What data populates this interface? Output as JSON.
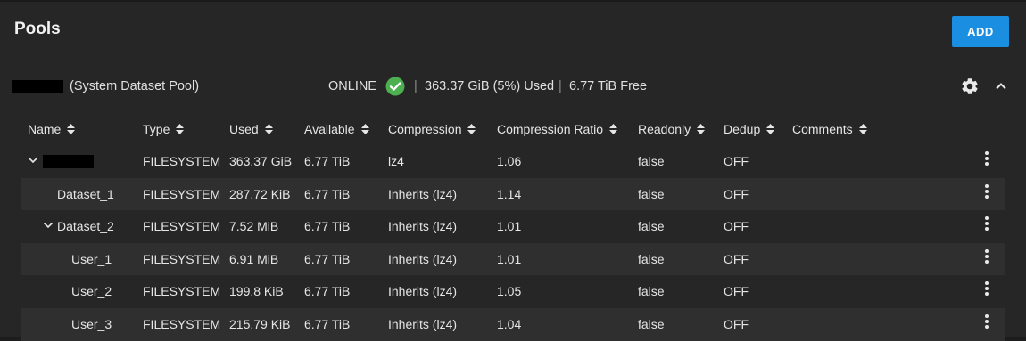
{
  "page": {
    "title": "Pools"
  },
  "actions": {
    "add_label": "ADD"
  },
  "pool": {
    "label": "(System Dataset Pool)",
    "status": "ONLINE",
    "used": "363.37 GiB (5%) Used",
    "free": "6.77 TiB Free",
    "separator": "|"
  },
  "columns": [
    {
      "label": "Name"
    },
    {
      "label": "Type"
    },
    {
      "label": "Used"
    },
    {
      "label": "Available"
    },
    {
      "label": "Compression"
    },
    {
      "label": "Compression Ratio"
    },
    {
      "label": "Readonly"
    },
    {
      "label": "Dedup"
    },
    {
      "label": "Comments"
    }
  ],
  "rows": [
    {
      "name": "",
      "redacted": true,
      "indent": 0,
      "expander": true,
      "type": "FILESYSTEM",
      "used": "363.37 GiB",
      "available": "6.77 TiB",
      "compression": "lz4",
      "ratio": "1.06",
      "readonly": "false",
      "dedup": "OFF"
    },
    {
      "name": "Dataset_1",
      "indent": 1,
      "expander": false,
      "type": "FILESYSTEM",
      "used": "287.72 KiB",
      "available": "6.77 TiB",
      "compression": "Inherits (lz4)",
      "ratio": "1.14",
      "readonly": "false",
      "dedup": "OFF"
    },
    {
      "name": "Dataset_2",
      "indent": 1,
      "expander": true,
      "type": "FILESYSTEM",
      "used": "7.52 MiB",
      "available": "6.77 TiB",
      "compression": "Inherits (lz4)",
      "ratio": "1.01",
      "readonly": "false",
      "dedup": "OFF"
    },
    {
      "name": "User_1",
      "indent": 2,
      "expander": false,
      "type": "FILESYSTEM",
      "used": "6.91 MiB",
      "available": "6.77 TiB",
      "compression": "Inherits (lz4)",
      "ratio": "1.01",
      "readonly": "false",
      "dedup": "OFF"
    },
    {
      "name": "User_2",
      "indent": 2,
      "expander": false,
      "type": "FILESYSTEM",
      "used": "199.8 KiB",
      "available": "6.77 TiB",
      "compression": "Inherits (lz4)",
      "ratio": "1.05",
      "readonly": "false",
      "dedup": "OFF"
    },
    {
      "name": "User_3",
      "indent": 2,
      "expander": false,
      "type": "FILESYSTEM",
      "used": "215.79 KiB",
      "available": "6.77 TiB",
      "compression": "Inherits (lz4)",
      "ratio": "1.04",
      "readonly": "false",
      "dedup": "OFF"
    }
  ],
  "icons": {
    "status": "check-circle-icon",
    "settings": "gear-icon",
    "collapse": "chevron-up-icon",
    "sort": "sort-icon",
    "expand": "chevron-down-icon",
    "row_menu": "more-vert-icon"
  },
  "colors": {
    "accent": "#1a8ee0",
    "online": "#4caf50",
    "background": "#262626",
    "row_alt": "#2f2f2f"
  }
}
